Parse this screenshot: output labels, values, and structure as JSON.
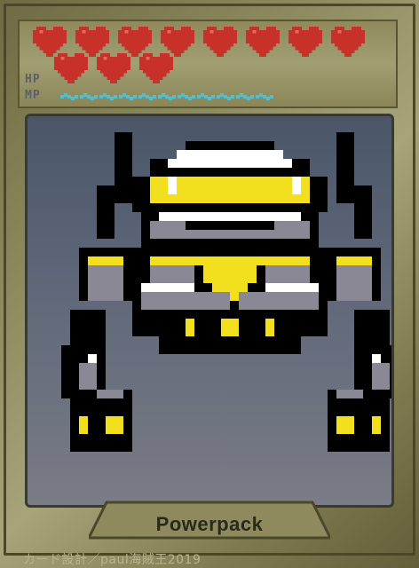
{
  "card": {
    "name": "Powerpack",
    "credit": "カード設計／paul海賊王2019"
  },
  "stats": {
    "hp_label": "HP",
    "mp_label": "MP",
    "hp_hearts": 11,
    "mp_pips": 11
  },
  "colors": {
    "heart": "#c8302a",
    "mp": "#4ec0d4",
    "robot_yellow": "#f2e01e",
    "robot_gray": "#8a8894",
    "robot_black": "#000000",
    "robot_white": "#ffffff"
  },
  "icons": {
    "heart": "heart-icon",
    "mp_pip": "mp-pip-icon"
  }
}
